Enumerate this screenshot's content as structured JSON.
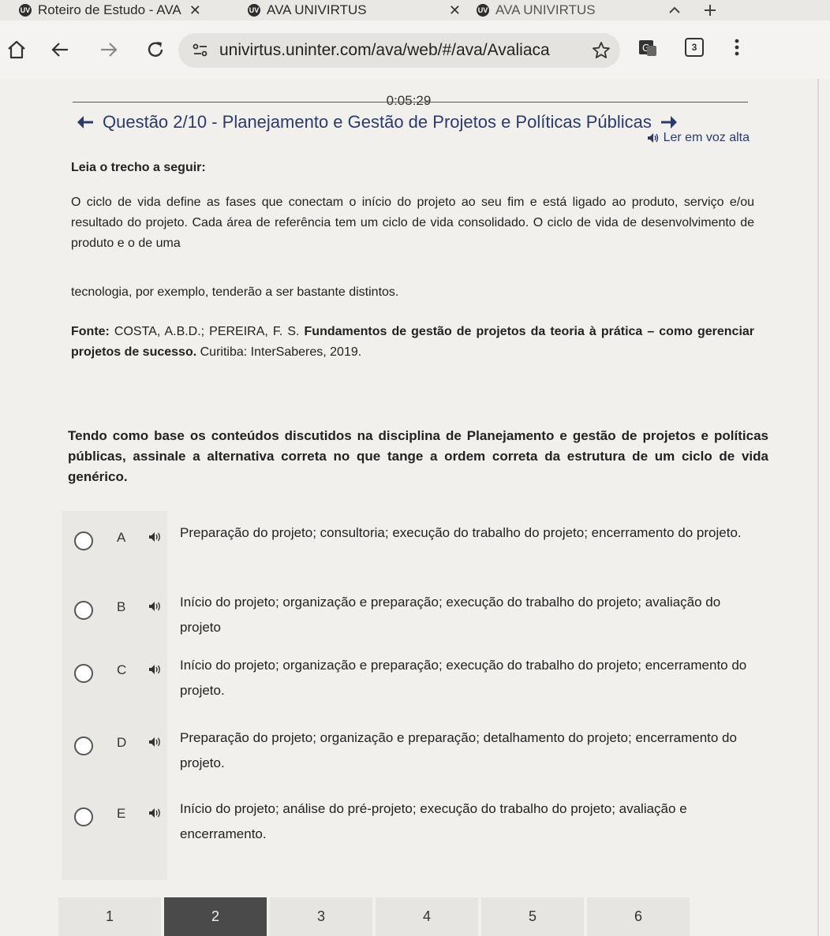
{
  "browser": {
    "tabs": [
      {
        "title": "Roteiro de Estudo - AVA",
        "close": "✕"
      },
      {
        "title": "AVA UNIVIRTUS",
        "close": "✕"
      },
      {
        "title": "AVA UNIVIRTUS",
        "close": ""
      }
    ],
    "url": "univirtus.uninter.com/ava/web/#/ava/Avaliaca",
    "tab_count": "3",
    "favicon_text": "UV"
  },
  "quiz": {
    "timer": "0:05:29",
    "question_title": "Questão 2/10 - Planejamento e Gestão de Projetos e Políticas Públicas",
    "read_aloud": "Ler em voz alta",
    "lead": "Leia o trecho a seguir:",
    "excerpt_p1": "O ciclo de vida define as fases que conectam o início do projeto ao seu fim e está ligado ao produto, serviço e/ou resultado do projeto. Cada área de referência tem um ciclo de vida consolidado. O ciclo de vida de desenvolvimento de produto e o de uma",
    "excerpt_p2": "tecnologia, por exemplo, tenderão a ser bastante distintos.",
    "source_label": "Fonte:",
    "source_authors": "COSTA, A.B.D.; PEREIRA, F. S.",
    "source_title": "Fundamentos de gestão de projetos da teoria à prática – como gerenciar projetos de sucesso.",
    "source_publisher": "Curitiba: InterSaberes, 2019.",
    "question": "Tendo como base os conteúdos discutidos na disciplina de Planejamento e gestão de projetos e políticas públicas, assinale a alternativa correta no que tange a ordem correta da estrutura de um ciclo de vida genérico.",
    "options": [
      {
        "letter": "A",
        "text": "Preparação do projeto; consultoria; execução do trabalho do projeto; encerramento do projeto."
      },
      {
        "letter": "B",
        "text": "Início do projeto; organização e preparação; execução do trabalho do projeto; avaliação do projeto"
      },
      {
        "letter": "C",
        "text": "Início do projeto; organização e preparação; execução do trabalho do projeto; encerramento do projeto."
      },
      {
        "letter": "D",
        "text": "Preparação do projeto; organização e preparação; detalhamento do projeto; encerramento do projeto."
      },
      {
        "letter": "E",
        "text": "Início do projeto; análise do pré-projeto; execução do trabalho do projeto; avaliação e encerramento."
      }
    ],
    "pages": [
      "1",
      "2",
      "3",
      "4",
      "5",
      "6"
    ],
    "current_page": "2"
  }
}
